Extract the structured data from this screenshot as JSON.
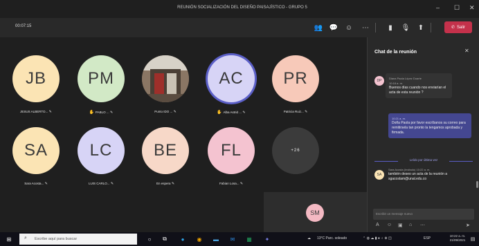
{
  "window": {
    "title": "REUNIÓN SOCIALIZACIÓN DEL DISEÑO PAISAJÍSTICO - GRUPO 5"
  },
  "toolbar": {
    "timer": "00:07:15",
    "leave_label": "Salir"
  },
  "participants": [
    {
      "initials": "JB",
      "name": "JESUS ALBERTO...",
      "color": "#fbe4b4"
    },
    {
      "initials": "PM",
      "name": "PABLO ...",
      "color": "#d2e9c6",
      "hand": true
    },
    {
      "initials": "",
      "name": "Punto IDO ...",
      "photo": true
    },
    {
      "initials": "AC",
      "name": "Alba Astrid ...",
      "color": "#d7d4f6",
      "hand": true,
      "active": true
    },
    {
      "initials": "PR",
      "name": "Patricia Ruiz...",
      "color": "#f7c9b9"
    },
    {
      "initials": "SA",
      "name": "Sara Acosta...",
      "color": "#fbe4b4"
    },
    {
      "initials": "LC",
      "name": "LUIS CARLO...",
      "color": "#d7d4f6"
    },
    {
      "initials": "BE",
      "name": "En espera",
      "color": "#f7d8c8"
    },
    {
      "initials": "FL",
      "name": "Fabian Losa...",
      "color": "#f4c3d0"
    },
    {
      "initials": "+26",
      "name": "",
      "color": "#3b3b3b",
      "overflow": true
    }
  ],
  "self_preview": {
    "initials": "SM"
  },
  "chat": {
    "title": "Chat de la reunión",
    "messages": [
      {
        "avatar": "DP",
        "author": "Diana Paola López Duarte",
        "time": "10:18 a. m.",
        "text": "Buenos días cuando nos enviarían el acta de esta reunión ?"
      },
      {
        "mine": true,
        "time": "10:21 a. m.",
        "text": "Doña Paola por favor escríbanos su correo para remitirsela tan pronto la tengamos aprobada y firmada."
      },
      {
        "avatar": "SA",
        "author": "Sara Acosta (Invitado)",
        "time": "10:22 a. m.",
        "text": "también deseo un acta de la reunión a sgacostam@unal.edu.co"
      }
    ],
    "last_read": "Leído por última vez",
    "compose_placeholder": "Escribir un mensaje nuevo"
  },
  "taskbar": {
    "search_placeholder": "Escribe aquí para buscar",
    "weather": "13°C Parc. soleado",
    "lang": "ESP",
    "time": "10:22 a. m.",
    "date": "21/09/2021"
  },
  "colors": {
    "accent": "#5b5fc7",
    "leave": "#c4314b",
    "hand": "#f5b300"
  }
}
